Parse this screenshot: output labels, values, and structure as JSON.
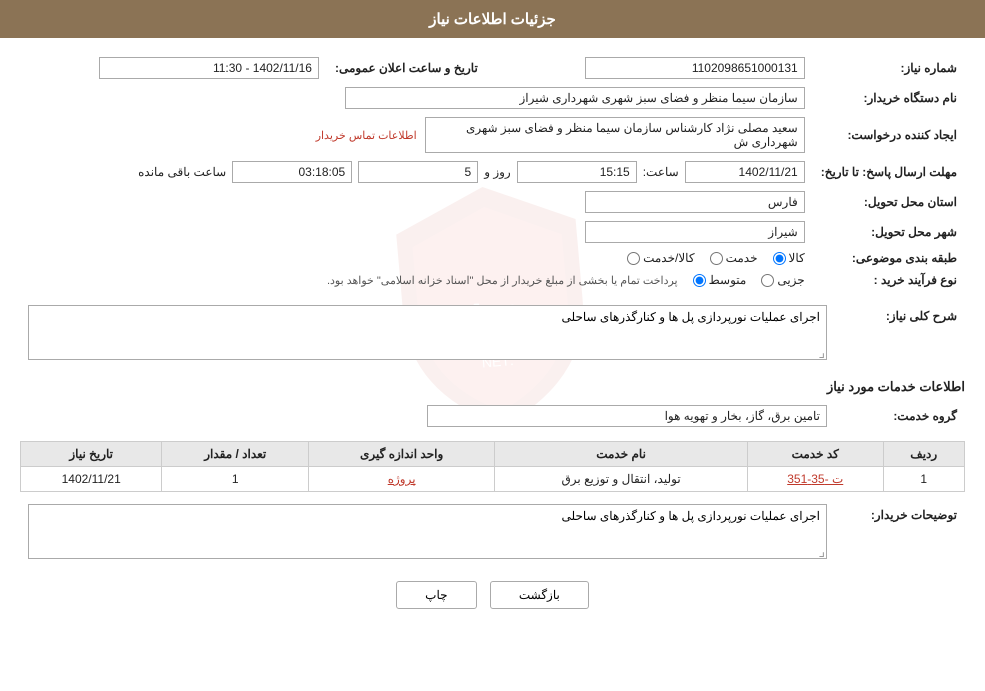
{
  "header": {
    "title": "جزئیات اطلاعات نیاز"
  },
  "fields": {
    "needNumber_label": "شماره نیاز:",
    "needNumber_value": "1102098651000131",
    "buyerOrg_label": "نام دستگاه خریدار:",
    "buyerOrg_value": "سازمان سیما منظر و فضای سبز شهری شهرداری شیراز",
    "creator_label": "ایجاد کننده درخواست:",
    "creator_value": "سعید مصلی نژاد کارشناس سازمان سیما منظر و فضای سبز شهری شهرداری ش",
    "contact_link": "اطلاعات تماس خریدار",
    "sendDeadline_label": "مهلت ارسال پاسخ: تا تاریخ:",
    "date_value": "1402/11/21",
    "time_label": "ساعت:",
    "time_value": "15:15",
    "day_label": "روز و",
    "days_value": "5",
    "remaining_label": "ساعت باقی مانده",
    "remaining_value": "03:18:05",
    "announcement_label": "تاریخ و ساعت اعلان عمومی:",
    "announcement_value": "1402/11/16 - 11:30",
    "province_label": "استان محل تحویل:",
    "province_value": "فارس",
    "city_label": "شهر محل تحویل:",
    "city_value": "شیراز",
    "category_label": "طبقه بندی موضوعی:",
    "category_options": [
      {
        "id": "kala",
        "label": "کالا",
        "checked": true
      },
      {
        "id": "khadamat",
        "label": "خدمت",
        "checked": false
      },
      {
        "id": "kala_khadamat",
        "label": "کالا/خدمت",
        "checked": false
      }
    ],
    "processType_label": "نوع فرآیند خرید :",
    "process_options": [
      {
        "id": "jozee",
        "label": "جزیی",
        "checked": false
      },
      {
        "id": "motevaset",
        "label": "متوسط",
        "checked": true
      }
    ],
    "process_note": "پرداخت تمام یا بخشی از مبلغ خریدار از محل \"اسناد خزانه اسلامی\" خواهد بود."
  },
  "description_section": {
    "title": "شرح کلی نیاز:",
    "value": "اجرای عملیات نورپردازی پل ها و کنارگذرهای ساحلی"
  },
  "services_section": {
    "title": "اطلاعات خدمات مورد نیاز",
    "serviceGroup_label": "گروه خدمت:",
    "serviceGroup_value": "تامین برق، گاز، بخار و تهویه هوا",
    "table": {
      "headers": [
        "ردیف",
        "کد خدمت",
        "نام خدمت",
        "واحد اندازه گیری",
        "تعداد / مقدار",
        "تاریخ نیاز"
      ],
      "rows": [
        {
          "row": "1",
          "code": "ت -35-351",
          "name": "تولید، انتقال و توزیع برق",
          "unit": "پروژه",
          "count": "1",
          "date": "1402/11/21"
        }
      ]
    }
  },
  "buyer_description": {
    "title": "توضیحات خریدار:",
    "value": "اجرای عملیات نورپردازی پل ها و کنارگذرهای ساحلی"
  },
  "buttons": {
    "print": "چاپ",
    "back": "بازگشت"
  }
}
